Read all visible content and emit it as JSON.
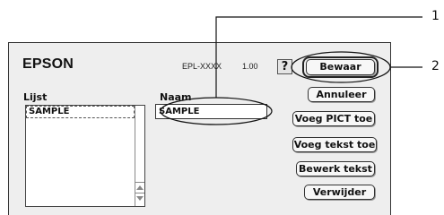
{
  "header": {
    "logo": "EPSON",
    "model": "EPL-XXXX",
    "version": "1.00",
    "help_label": "?"
  },
  "list": {
    "label": "Lijst",
    "items": [
      "SAMPLE"
    ]
  },
  "name": {
    "label": "Naam",
    "value": "SAMPLE"
  },
  "buttons": {
    "save": "Bewaar",
    "cancel": "Annuleer",
    "add_pict": "Voeg PICT toe",
    "add_text": "Voeg tekst toe",
    "edit_text": "Bewerk tekst",
    "delete": "Verwijder"
  },
  "callouts": {
    "one": "1",
    "two": "2"
  }
}
